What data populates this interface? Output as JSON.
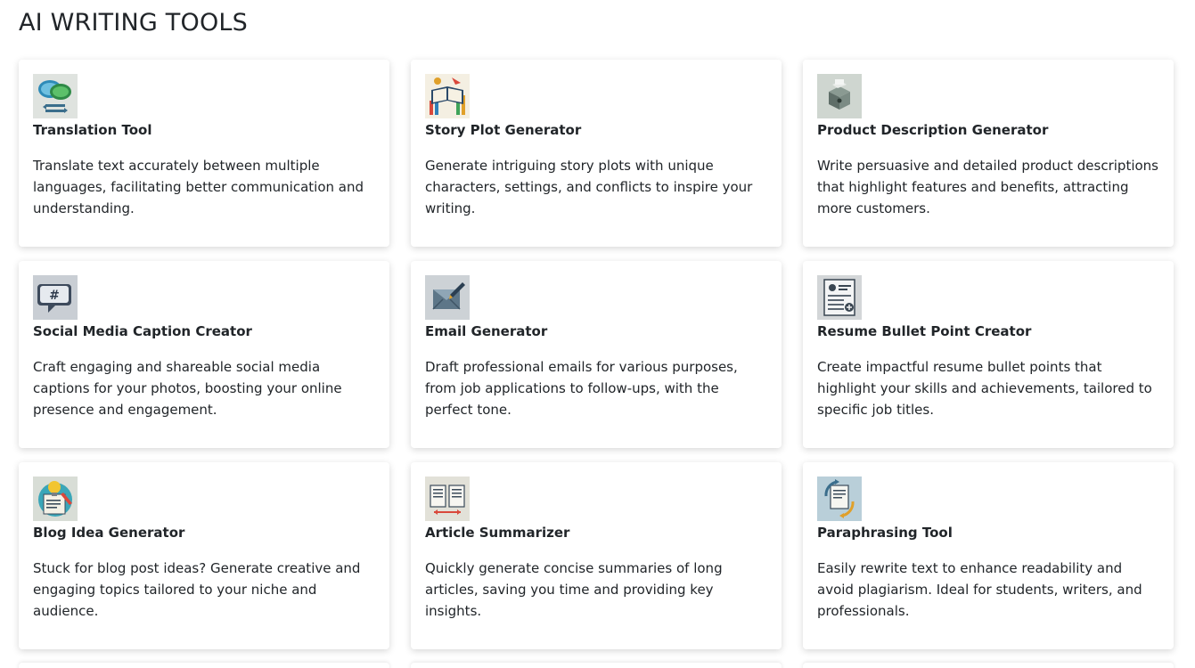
{
  "page": {
    "title": "AI WRITING TOOLS"
  },
  "tools": [
    {
      "icon": "translation-chat-bubbles-icon",
      "title": "Translation Tool",
      "description": "Translate text accurately between multiple languages, facilitating better communication and understanding."
    },
    {
      "icon": "open-book-story-icon",
      "title": "Story Plot Generator",
      "description": "Generate intriguing story plots with unique characters, settings, and conflicts to inspire your writing."
    },
    {
      "icon": "product-box-icon",
      "title": "Product Description Generator",
      "description": "Write persuasive and detailed product descriptions that highlight features and benefits, attracting more customers."
    },
    {
      "icon": "hashtag-speech-bubble-icon",
      "title": "Social Media Caption Creator",
      "description": "Craft engaging and shareable social media captions for your photos, boosting your online presence and engagement."
    },
    {
      "icon": "envelope-pen-icon",
      "title": "Email Generator",
      "description": "Draft professional emails for various purposes, from job applications to follow-ups, with the perfect tone."
    },
    {
      "icon": "resume-document-icon",
      "title": "Resume Bullet Point Creator",
      "description": "Create impactful resume bullet points that highlight your skills and achievements, tailored to specific job titles."
    },
    {
      "icon": "lightbulb-notepad-icon",
      "title": "Blog Idea Generator",
      "description": "Stuck for blog post ideas? Generate creative and engaging topics tailored to your niche and audience."
    },
    {
      "icon": "article-pages-arrow-icon",
      "title": "Article Summarizer",
      "description": "Quickly generate concise summaries of long articles, saving you time and providing key insights."
    },
    {
      "icon": "rewrite-document-arrows-icon",
      "title": "Paraphrasing Tool",
      "description": "Easily rewrite text to enhance readability and avoid plagiarism. Ideal for students, writers, and professionals."
    }
  ]
}
